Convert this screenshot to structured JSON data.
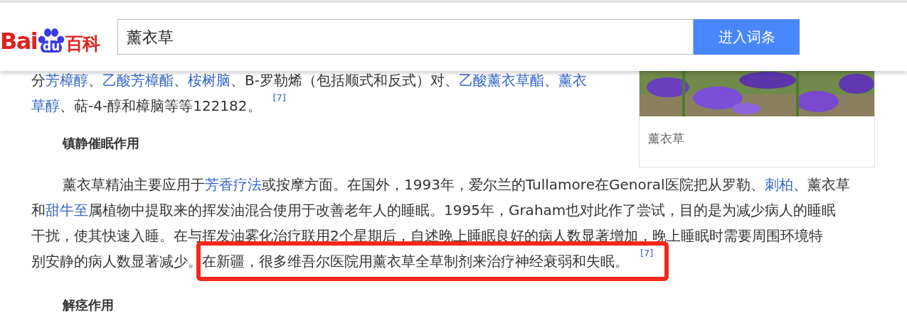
{
  "header": {
    "logo": {
      "latin": "Bai",
      "badge": "du",
      "chinese": "百科"
    },
    "search": {
      "value": "薰衣草"
    },
    "button": "进入词条"
  },
  "intro": {
    "lines": [
      [
        {
          "kind": "text",
          "text": "分"
        },
        {
          "kind": "link",
          "text": "芳樟醇"
        },
        {
          "kind": "text",
          "text": "、"
        },
        {
          "kind": "link",
          "text": "乙酸芳樟酯"
        },
        {
          "kind": "text",
          "text": "、"
        },
        {
          "kind": "link",
          "text": "桉树脑"
        },
        {
          "kind": "text",
          "text": "、B-罗勒烯（包括顺式和反式）对、"
        },
        {
          "kind": "link",
          "text": "乙酸薰衣草酯"
        },
        {
          "kind": "text",
          "text": "、"
        },
        {
          "kind": "link",
          "text": "薰衣"
        }
      ],
      [
        {
          "kind": "link",
          "text": "草醇"
        },
        {
          "kind": "text",
          "text": "、萜-4-醇和樟脑等等122182。"
        },
        {
          "kind": "ref",
          "text": "[7]"
        }
      ]
    ]
  },
  "figure": {
    "caption": "薰衣草"
  },
  "heading_1": "镇静催眠作用",
  "paragraph": {
    "lines": [
      [
        {
          "kind": "text",
          "text": "薰衣草精油主要应用于"
        },
        {
          "kind": "link",
          "text": "芳香疗法"
        },
        {
          "kind": "text",
          "text": "或按摩方面。在国外，1993年，爱尔兰的Tullamore在Genoral医院把从罗勒、"
        },
        {
          "kind": "link",
          "text": "刺柏"
        },
        {
          "kind": "text",
          "text": "、薰衣草"
        }
      ],
      [
        {
          "kind": "text",
          "text": "和"
        },
        {
          "kind": "link",
          "text": "甜牛至"
        },
        {
          "kind": "text",
          "text": "属植物中提取来的挥发油混合使用于改善老年人的睡眠。1995年，Graham也对此作了尝试，目的是为减少病人的睡眠"
        }
      ],
      [
        {
          "kind": "text",
          "text": "干扰，使其快速入睡。在与挥发油雾化治疗联用2个星期后，自述晚上睡眠良好的病人数显著增加，晚上睡眠时需要周围环境特"
        }
      ],
      [
        {
          "kind": "text",
          "text": "别安静的病人数显著减少。"
        },
        {
          "kind": "highlight",
          "segments": [
            {
              "kind": "text",
              "text": "在新疆，很多维吾尔医院用薰衣草全草制剂来治疗神经衰弱和失眠。"
            },
            {
              "kind": "ref",
              "text": "[7]"
            }
          ]
        }
      ]
    ]
  },
  "heading_2": "解痉作用"
}
